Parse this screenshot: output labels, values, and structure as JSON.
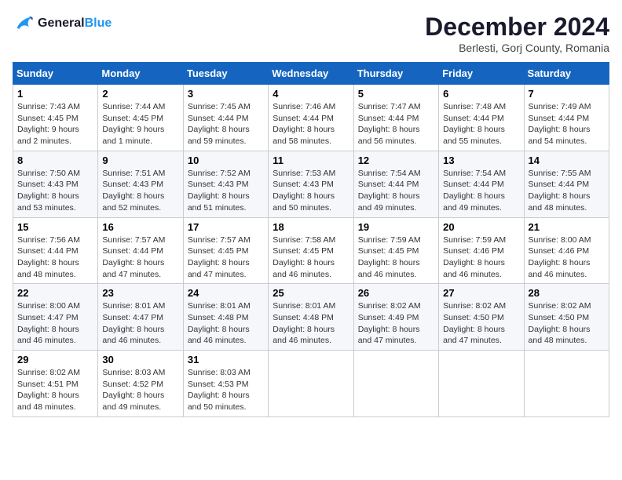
{
  "logo": {
    "line1": "General",
    "line2": "Blue"
  },
  "title": "December 2024",
  "location": "Berlesti, Gorj County, Romania",
  "weekdays": [
    "Sunday",
    "Monday",
    "Tuesday",
    "Wednesday",
    "Thursday",
    "Friday",
    "Saturday"
  ],
  "weeks": [
    [
      {
        "day": "1",
        "sunrise": "7:43 AM",
        "sunset": "4:45 PM",
        "daylight": "9 hours and 2 minutes."
      },
      {
        "day": "2",
        "sunrise": "7:44 AM",
        "sunset": "4:45 PM",
        "daylight": "9 hours and 1 minute."
      },
      {
        "day": "3",
        "sunrise": "7:45 AM",
        "sunset": "4:44 PM",
        "daylight": "8 hours and 59 minutes."
      },
      {
        "day": "4",
        "sunrise": "7:46 AM",
        "sunset": "4:44 PM",
        "daylight": "8 hours and 58 minutes."
      },
      {
        "day": "5",
        "sunrise": "7:47 AM",
        "sunset": "4:44 PM",
        "daylight": "8 hours and 56 minutes."
      },
      {
        "day": "6",
        "sunrise": "7:48 AM",
        "sunset": "4:44 PM",
        "daylight": "8 hours and 55 minutes."
      },
      {
        "day": "7",
        "sunrise": "7:49 AM",
        "sunset": "4:44 PM",
        "daylight": "8 hours and 54 minutes."
      }
    ],
    [
      {
        "day": "8",
        "sunrise": "7:50 AM",
        "sunset": "4:43 PM",
        "daylight": "8 hours and 53 minutes."
      },
      {
        "day": "9",
        "sunrise": "7:51 AM",
        "sunset": "4:43 PM",
        "daylight": "8 hours and 52 minutes."
      },
      {
        "day": "10",
        "sunrise": "7:52 AM",
        "sunset": "4:43 PM",
        "daylight": "8 hours and 51 minutes."
      },
      {
        "day": "11",
        "sunrise": "7:53 AM",
        "sunset": "4:43 PM",
        "daylight": "8 hours and 50 minutes."
      },
      {
        "day": "12",
        "sunrise": "7:54 AM",
        "sunset": "4:44 PM",
        "daylight": "8 hours and 49 minutes."
      },
      {
        "day": "13",
        "sunrise": "7:54 AM",
        "sunset": "4:44 PM",
        "daylight": "8 hours and 49 minutes."
      },
      {
        "day": "14",
        "sunrise": "7:55 AM",
        "sunset": "4:44 PM",
        "daylight": "8 hours and 48 minutes."
      }
    ],
    [
      {
        "day": "15",
        "sunrise": "7:56 AM",
        "sunset": "4:44 PM",
        "daylight": "8 hours and 48 minutes."
      },
      {
        "day": "16",
        "sunrise": "7:57 AM",
        "sunset": "4:44 PM",
        "daylight": "8 hours and 47 minutes."
      },
      {
        "day": "17",
        "sunrise": "7:57 AM",
        "sunset": "4:45 PM",
        "daylight": "8 hours and 47 minutes."
      },
      {
        "day": "18",
        "sunrise": "7:58 AM",
        "sunset": "4:45 PM",
        "daylight": "8 hours and 46 minutes."
      },
      {
        "day": "19",
        "sunrise": "7:59 AM",
        "sunset": "4:45 PM",
        "daylight": "8 hours and 46 minutes."
      },
      {
        "day": "20",
        "sunrise": "7:59 AM",
        "sunset": "4:46 PM",
        "daylight": "8 hours and 46 minutes."
      },
      {
        "day": "21",
        "sunrise": "8:00 AM",
        "sunset": "4:46 PM",
        "daylight": "8 hours and 46 minutes."
      }
    ],
    [
      {
        "day": "22",
        "sunrise": "8:00 AM",
        "sunset": "4:47 PM",
        "daylight": "8 hours and 46 minutes."
      },
      {
        "day": "23",
        "sunrise": "8:01 AM",
        "sunset": "4:47 PM",
        "daylight": "8 hours and 46 minutes."
      },
      {
        "day": "24",
        "sunrise": "8:01 AM",
        "sunset": "4:48 PM",
        "daylight": "8 hours and 46 minutes."
      },
      {
        "day": "25",
        "sunrise": "8:01 AM",
        "sunset": "4:48 PM",
        "daylight": "8 hours and 46 minutes."
      },
      {
        "day": "26",
        "sunrise": "8:02 AM",
        "sunset": "4:49 PM",
        "daylight": "8 hours and 47 minutes."
      },
      {
        "day": "27",
        "sunrise": "8:02 AM",
        "sunset": "4:50 PM",
        "daylight": "8 hours and 47 minutes."
      },
      {
        "day": "28",
        "sunrise": "8:02 AM",
        "sunset": "4:50 PM",
        "daylight": "8 hours and 48 minutes."
      }
    ],
    [
      {
        "day": "29",
        "sunrise": "8:02 AM",
        "sunset": "4:51 PM",
        "daylight": "8 hours and 48 minutes."
      },
      {
        "day": "30",
        "sunrise": "8:03 AM",
        "sunset": "4:52 PM",
        "daylight": "8 hours and 49 minutes."
      },
      {
        "day": "31",
        "sunrise": "8:03 AM",
        "sunset": "4:53 PM",
        "daylight": "8 hours and 50 minutes."
      },
      null,
      null,
      null,
      null
    ]
  ],
  "labels": {
    "sunrise": "Sunrise:",
    "sunset": "Sunset:",
    "daylight": "Daylight:"
  }
}
